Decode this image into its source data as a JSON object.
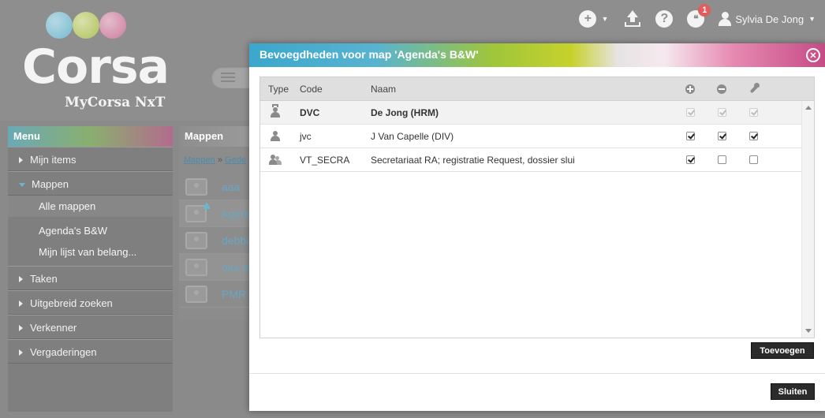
{
  "app": {
    "logo_text": "Corsa",
    "logo_sub": "MyCorsa NxT"
  },
  "topbar": {
    "plus_icon": "+",
    "help_icon": "?",
    "chat_badge": "1",
    "user_name": "Sylvia De Jong"
  },
  "sidebar": {
    "header": "Menu",
    "items": [
      {
        "label": "Mijn items"
      },
      {
        "label": "Mappen"
      },
      {
        "label": "Taken"
      },
      {
        "label": "Uitgebreid zoeken"
      },
      {
        "label": "Verkenner"
      },
      {
        "label": "Vergaderingen"
      }
    ],
    "sub_items": [
      {
        "label": "Alle mappen"
      },
      {
        "label": "Agenda's B&W"
      },
      {
        "label": "Mijn lijst van belang..."
      }
    ]
  },
  "folders_panel": {
    "header": "Mappen",
    "breadcrumb_root": "Mappen",
    "breadcrumb_sep": "»",
    "breadcrumb_current": "Gede",
    "items": [
      {
        "name": "aaa"
      },
      {
        "name": "Agend"
      },
      {
        "name": "debbi"
      },
      {
        "name": "oka te"
      },
      {
        "name": "PMR"
      }
    ]
  },
  "modal": {
    "title": "Bevoegdheden voor map 'Agenda's B&W'",
    "close_icon": "✕",
    "columns": {
      "type": "Type",
      "code": "Code",
      "naam": "Naam"
    },
    "rows": [
      {
        "type": "king-person",
        "code": "DVC",
        "naam": "De Jong (HRM)",
        "add": true,
        "remove": true,
        "manage": true,
        "disabled": true
      },
      {
        "type": "person",
        "code": "jvc",
        "naam": "J Van Capelle (DIV)",
        "add": true,
        "remove": true,
        "manage": true,
        "disabled": false
      },
      {
        "type": "group",
        "code": "VT_SECRA",
        "naam": "Secretariaat RA; registratie Request, dossier slui",
        "add": true,
        "remove": false,
        "manage": false,
        "disabled": false
      }
    ],
    "add_button": "Toevoegen",
    "close_button": "Sluiten"
  }
}
